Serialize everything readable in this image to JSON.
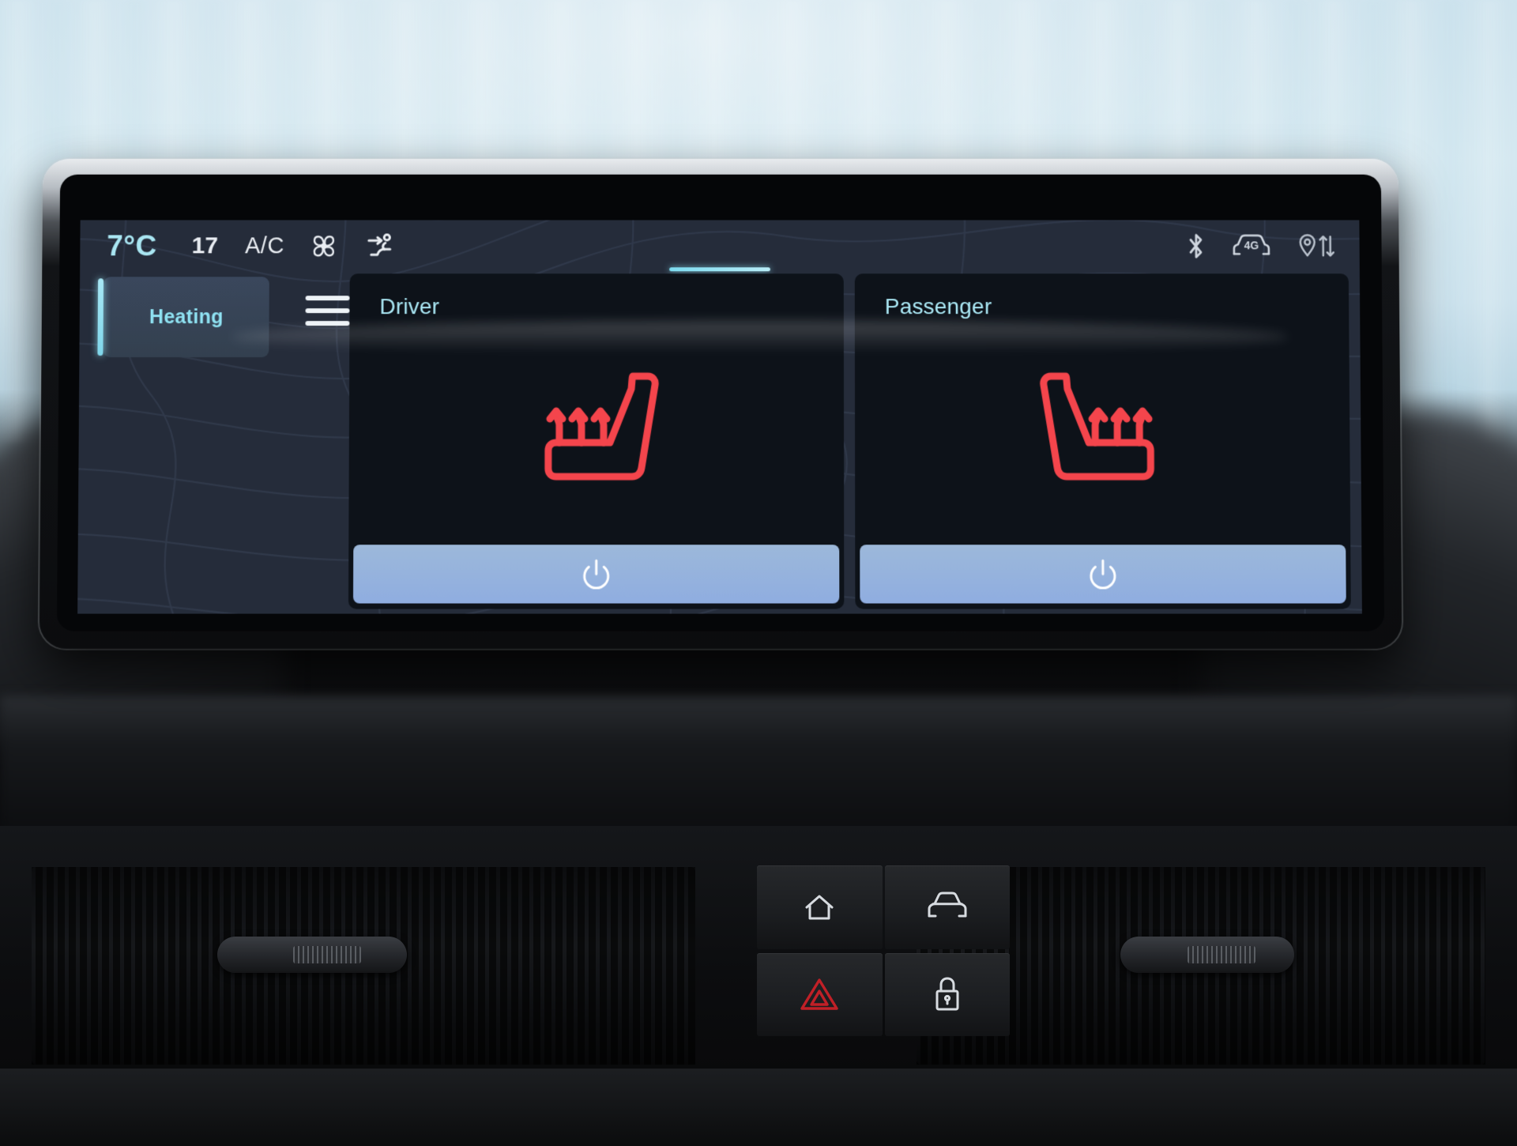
{
  "statusbar": {
    "outside_temp": "7°C",
    "setpoint": "17",
    "ac_label": "A/C",
    "fan_icon": "fan-icon",
    "airflow_icon": "airflow-body-icon",
    "bluetooth_icon": "bluetooth-icon",
    "network_icon": "car-4g-icon",
    "network_label": "4G",
    "location_icon": "location-pin-sync-icon"
  },
  "climate": {
    "mode_tab": {
      "label": "Heating",
      "selected": true
    },
    "menu_icon": "hamburger-menu-icon",
    "tab_indicator": "active-page-indicator"
  },
  "seats": [
    {
      "id": "driver",
      "title": "Driver",
      "seat_icon": "seat-heating-icon",
      "heat_level": 3,
      "power_icon": "power-icon",
      "power_state": "on"
    },
    {
      "id": "passenger",
      "title": "Passenger",
      "seat_icon": "seat-heating-icon-mirrored",
      "heat_level": 3,
      "power_icon": "power-icon",
      "power_state": "on"
    }
  ],
  "hard_buttons": [
    {
      "id": "home",
      "icon": "home-icon"
    },
    {
      "id": "car",
      "icon": "car-front-icon"
    },
    {
      "id": "hazard",
      "icon": "hazard-triangle-icon"
    },
    {
      "id": "lock",
      "icon": "lock-icon"
    }
  ],
  "colors": {
    "accent_cyan": "#8fe2f2",
    "ui_background": "#252c3a",
    "card_background": "#0d1219",
    "power_button": "#93b1d4",
    "seat_heat_red": "#f4454c",
    "hazard_red": "#c02027",
    "text_primary": "#e9edf2"
  }
}
